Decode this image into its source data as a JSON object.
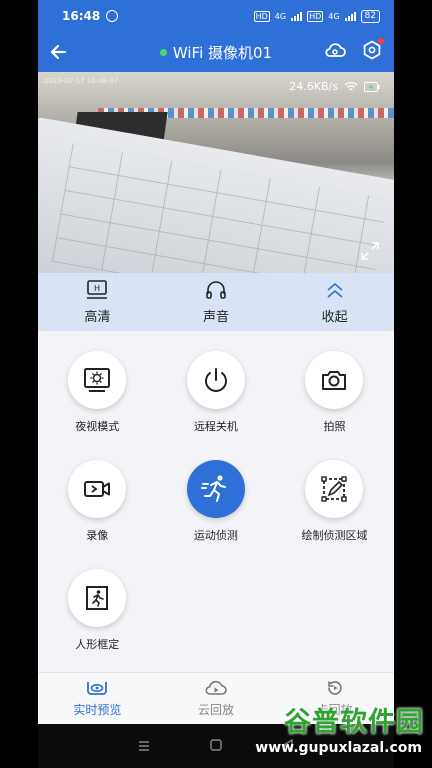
{
  "status": {
    "time": "16:48",
    "network1": "4G",
    "network2": "4G",
    "battery": "82"
  },
  "header": {
    "title": "WiFi 摄像机01",
    "online_color": "#4cd964",
    "accent": "#2f6fd8"
  },
  "video": {
    "timestamp": "2023-02-17  16:48:07",
    "speed": "24.6KB/s"
  },
  "controls": [
    {
      "label": "高清",
      "icon": "hd-icon"
    },
    {
      "label": "声音",
      "icon": "headphones-icon"
    },
    {
      "label": "收起",
      "icon": "collapse-icon"
    }
  ],
  "features": [
    {
      "label": "夜视模式",
      "icon": "night-vision-icon"
    },
    {
      "label": "远程关机",
      "icon": "power-icon"
    },
    {
      "label": "拍照",
      "icon": "camera-icon"
    },
    {
      "label": "录像",
      "icon": "video-record-icon"
    },
    {
      "label": "运动侦测",
      "icon": "running-person-icon",
      "active": true
    },
    {
      "label": "绘制侦测区域",
      "icon": "draw-area-icon"
    },
    {
      "label": "人形框定",
      "icon": "human-frame-icon"
    }
  ],
  "nav": [
    {
      "label": "实时预览",
      "icon": "eye-icon",
      "active": true
    },
    {
      "label": "云回放",
      "icon": "cloud-play-icon"
    },
    {
      "label": "卡回放",
      "icon": "replay-icon"
    }
  ],
  "watermark": {
    "brand": "谷普软件园",
    "url": "www.gupuxlazal.com"
  }
}
